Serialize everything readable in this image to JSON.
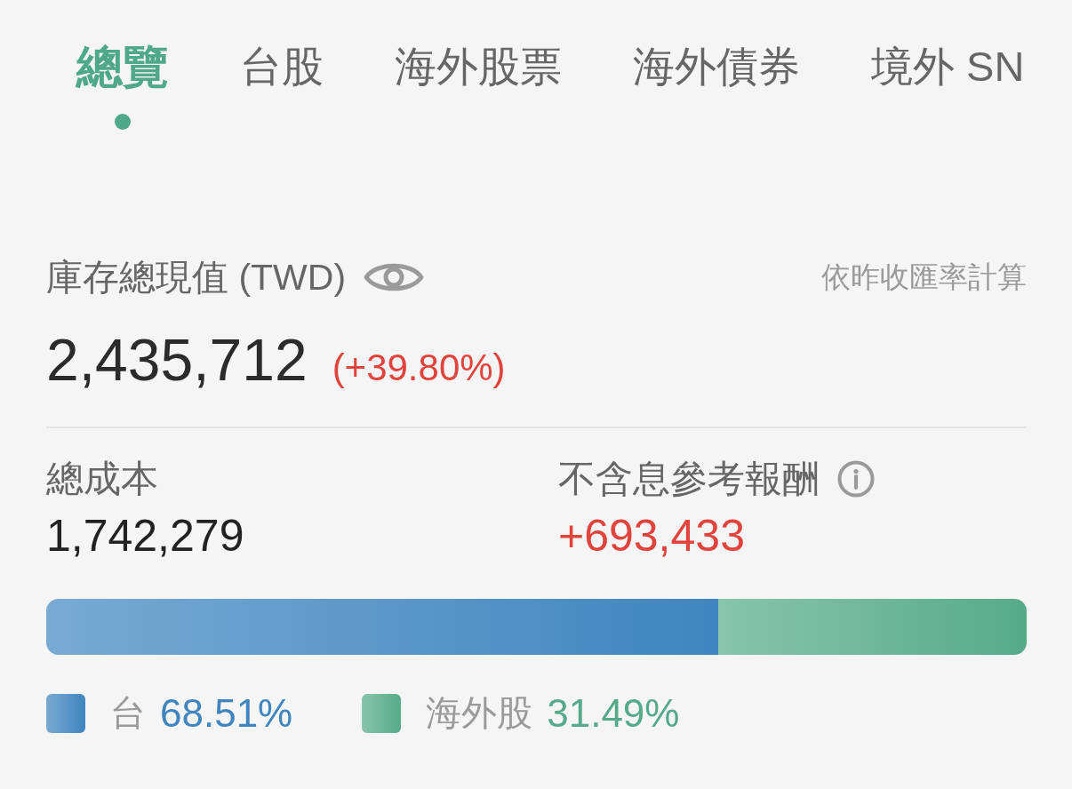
{
  "tabs": [
    {
      "label": "總覽",
      "selected": true
    },
    {
      "label": "台股",
      "selected": false
    },
    {
      "label": "海外股票",
      "selected": false
    },
    {
      "label": "海外債券",
      "selected": false
    },
    {
      "label": "境外 SN",
      "selected": false
    }
  ],
  "inventory": {
    "label": "庫存總現值 (TWD)",
    "note": "依昨收匯率計算",
    "value": "2,435,712",
    "change": "(+39.80%)"
  },
  "stats": [
    {
      "label": "總成本",
      "value": "1,742,279",
      "kind": "plain",
      "info": false
    },
    {
      "label": "不含息參考報酬",
      "value": "+693,433",
      "kind": "gain",
      "info": true
    }
  ],
  "allocation": {
    "segments": [
      {
        "name": "台",
        "percent": "68.51%",
        "level": 0.6851,
        "color": "#3f85bf"
      },
      {
        "name": "海外股",
        "percent": "31.49%",
        "level": 0.3149,
        "color": "#56aa8a"
      }
    ]
  }
}
